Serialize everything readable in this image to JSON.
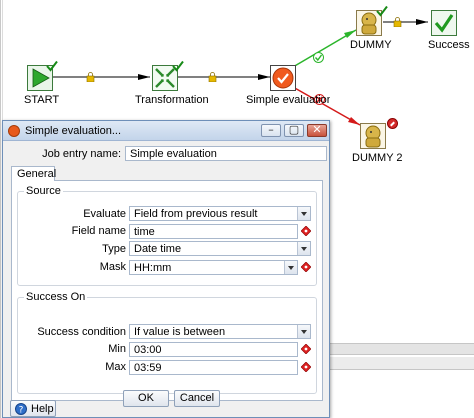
{
  "canvas": {
    "nodes": {
      "start": {
        "label": "START"
      },
      "transformation": {
        "label": "Transformation"
      },
      "simple_evaluation": {
        "label": "Simple evaluation"
      },
      "dummy": {
        "label": "DUMMY"
      },
      "success": {
        "label": "Success"
      },
      "dummy2": {
        "label": "DUMMY 2"
      }
    }
  },
  "dialog": {
    "title": "Simple evaluation...",
    "window_buttons": {
      "minimize": "–",
      "maximize": "▢",
      "close": "✕"
    },
    "job_entry_name": {
      "label": "Job entry name:",
      "value": "Simple evaluation"
    },
    "tabs": [
      {
        "label": "General"
      }
    ],
    "source": {
      "title": "Source",
      "evaluate": {
        "label": "Evaluate",
        "value": "Field from previous result"
      },
      "field_name": {
        "label": "Field name",
        "value": "time"
      },
      "type": {
        "label": "Type",
        "value": "Date time"
      },
      "mask": {
        "label": "Mask",
        "value": "HH:mm"
      }
    },
    "success_on": {
      "title": "Success On",
      "condition": {
        "label": "Success condition",
        "value": "If value is between"
      },
      "min": {
        "label": "Min",
        "value": "03:00"
      },
      "max": {
        "label": "Max",
        "value": "03:59"
      }
    },
    "buttons": {
      "ok": "OK",
      "cancel": "Cancel",
      "help": "Help"
    }
  }
}
